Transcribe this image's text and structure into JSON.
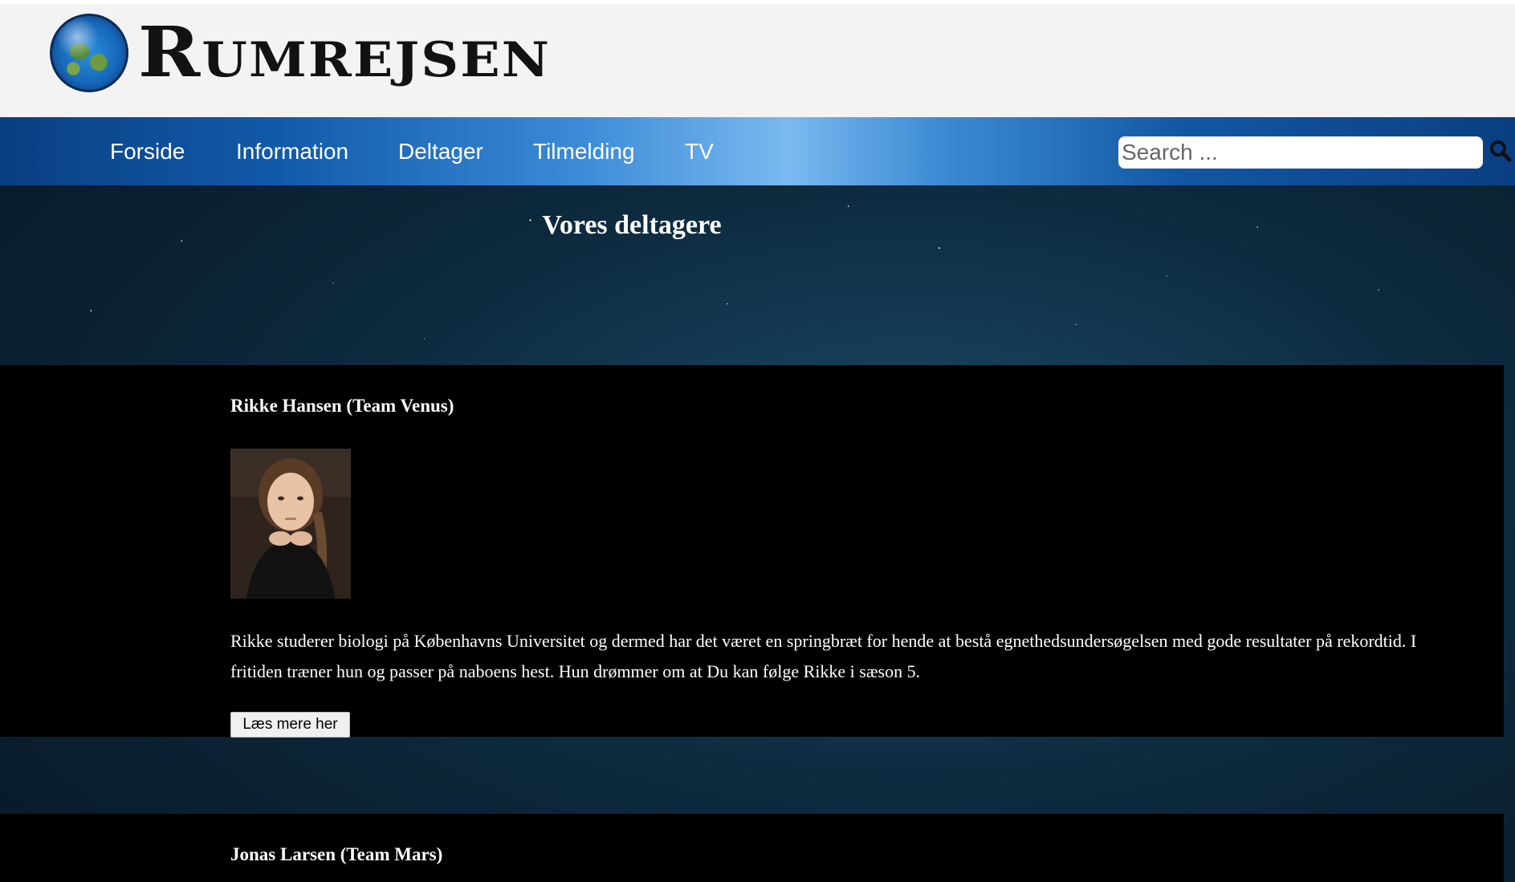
{
  "site": {
    "logo_text": "Rumrejsen"
  },
  "nav": {
    "items": [
      {
        "label": "Forside"
      },
      {
        "label": "Information"
      },
      {
        "label": "Deltager"
      },
      {
        "label": "Tilmelding"
      },
      {
        "label": "TV"
      }
    ],
    "search_placeholder": "Search ..."
  },
  "page": {
    "title": "Vores deltagere"
  },
  "participants": [
    {
      "name": "Rikke Hansen (Team Venus)",
      "description": "Rikke studerer biologi på Københavns Universitet og dermed har det været en springbræt for hende at bestå egnethedsundersøgelsen med gode resultater på rekordtid. I fritiden træner hun og passer på naboens hest. Hun drømmer om at Du kan følge Rikke i sæson 5.",
      "button_label": "Læs mere her"
    },
    {
      "name": "Jonas Larsen (Team Mars)"
    }
  ],
  "colors": {
    "header_bg": "#f3f3f3",
    "nav_blue": "#1159a8",
    "card_bg": "#000000",
    "text_light": "#ffffff"
  }
}
